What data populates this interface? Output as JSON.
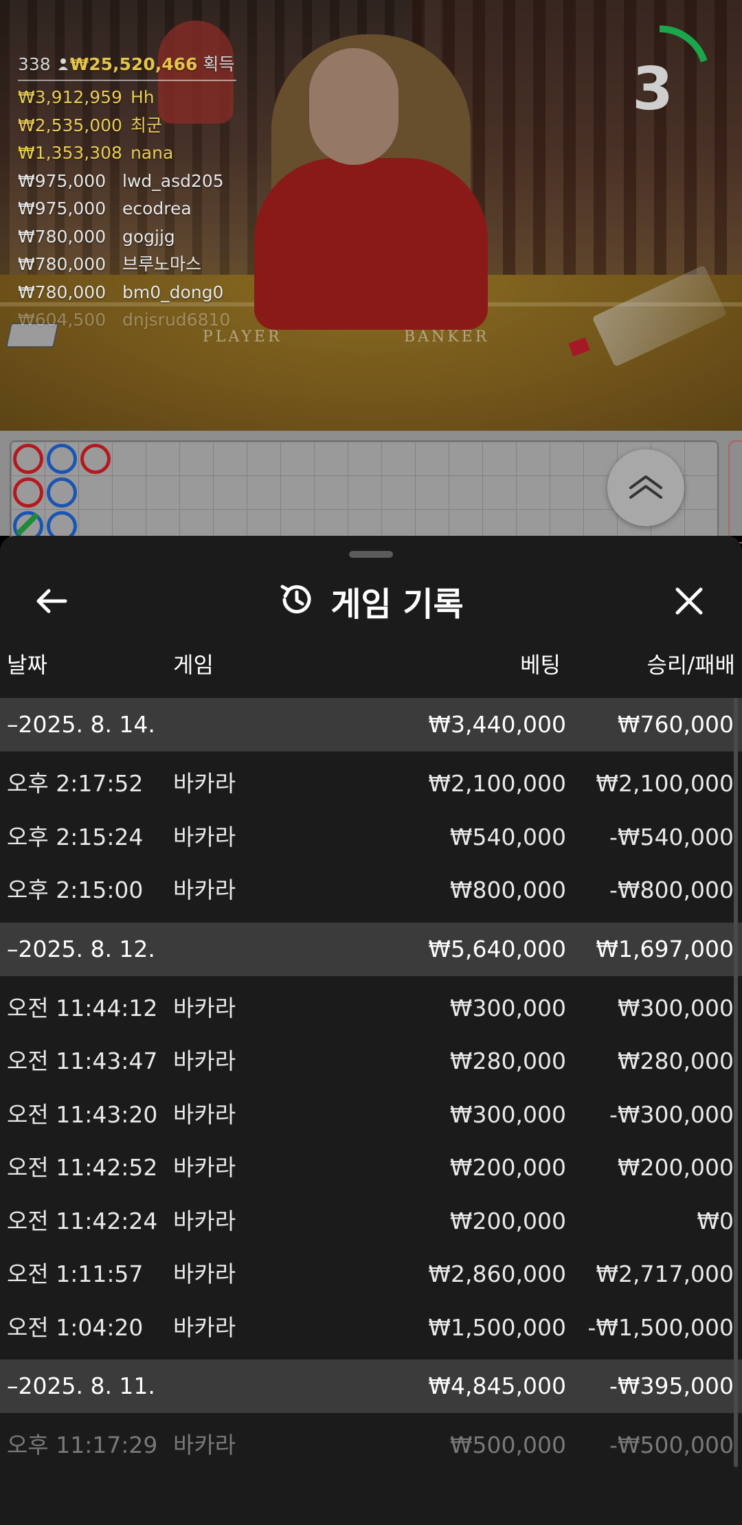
{
  "leaderboard": {
    "player_count": "338",
    "total_amount": "₩25,520,466",
    "total_label": "획득",
    "rows": [
      {
        "amount": "₩3,912,959",
        "name": "Hh",
        "style": "gold"
      },
      {
        "amount": "₩2,535,000",
        "name": "최군",
        "style": "gold"
      },
      {
        "amount": "₩1,353,308",
        "name": "nana",
        "style": "gold"
      },
      {
        "amount": "₩975,000",
        "name": "lwd_asd205",
        "style": "plain"
      },
      {
        "amount": "₩975,000",
        "name": "ecodrea",
        "style": "plain"
      },
      {
        "amount": "₩780,000",
        "name": "gogjjg",
        "style": "plain"
      },
      {
        "amount": "₩780,000",
        "name": "브루노마스",
        "style": "plain"
      },
      {
        "amount": "₩780,000",
        "name": "bm0_dong0",
        "style": "plain"
      },
      {
        "amount": "₩604,500",
        "name": "dnjsrud6810",
        "style": "faded"
      }
    ]
  },
  "table_labels": {
    "player": "PLAYER",
    "banker": "BANKER"
  },
  "timer": {
    "seconds": "3",
    "progress": 0.2,
    "color": "#1aa64a"
  },
  "road_map": {
    "beads": [
      {
        "col": 0,
        "row": 0,
        "result": "banker"
      },
      {
        "col": 1,
        "row": 0,
        "result": "player"
      },
      {
        "col": 2,
        "row": 0,
        "result": "banker"
      },
      {
        "col": 0,
        "row": 1,
        "result": "banker"
      },
      {
        "col": 1,
        "row": 1,
        "result": "player"
      },
      {
        "col": 0,
        "row": 2,
        "result": "player",
        "tie": true
      },
      {
        "col": 1,
        "row": 2,
        "result": "player"
      }
    ],
    "colors": {
      "banker": "#b3191e",
      "player": "#1a55b3",
      "tie": "#1f8a3a"
    }
  },
  "sheet": {
    "title": "게임 기록",
    "title_icon": "history-icon",
    "back_icon": "arrow-left-icon",
    "close_icon": "close-icon",
    "columns": {
      "date": "날짜",
      "game": "게임",
      "bet": "베팅",
      "win_loss": "승리/패배"
    },
    "groups": [
      {
        "date": "–2025. 8. 14.",
        "bet": "₩3,440,000",
        "win_loss": "₩760,000",
        "items": [
          {
            "time": "오후 2:17:52",
            "game": "바카라",
            "bet": "₩2,100,000",
            "win_loss": "₩2,100,000"
          },
          {
            "time": "오후 2:15:24",
            "game": "바카라",
            "bet": "₩540,000",
            "win_loss": "-₩540,000"
          },
          {
            "time": "오후 2:15:00",
            "game": "바카라",
            "bet": "₩800,000",
            "win_loss": "-₩800,000"
          }
        ]
      },
      {
        "date": "–2025. 8. 12.",
        "bet": "₩5,640,000",
        "win_loss": "₩1,697,000",
        "items": [
          {
            "time": "오전 11:44:12",
            "game": "바카라",
            "bet": "₩300,000",
            "win_loss": "₩300,000"
          },
          {
            "time": "오전 11:43:47",
            "game": "바카라",
            "bet": "₩280,000",
            "win_loss": "₩280,000"
          },
          {
            "time": "오전 11:43:20",
            "game": "바카라",
            "bet": "₩300,000",
            "win_loss": "-₩300,000"
          },
          {
            "time": "오전 11:42:52",
            "game": "바카라",
            "bet": "₩200,000",
            "win_loss": "₩200,000"
          },
          {
            "time": "오전 11:42:24",
            "game": "바카라",
            "bet": "₩200,000",
            "win_loss": "₩0"
          },
          {
            "time": "오전 1:11:57",
            "game": "바카라",
            "bet": "₩2,860,000",
            "win_loss": "₩2,717,000"
          },
          {
            "time": "오전 1:04:20",
            "game": "바카라",
            "bet": "₩1,500,000",
            "win_loss": "-₩1,500,000"
          }
        ]
      },
      {
        "date": "–2025. 8. 11.",
        "bet": "₩4,845,000",
        "win_loss": "-₩395,000",
        "items": [
          {
            "time": "오후 11:17:29",
            "game": "바카라",
            "bet": "₩500,000",
            "win_loss": "-₩500,000"
          }
        ]
      }
    ]
  }
}
